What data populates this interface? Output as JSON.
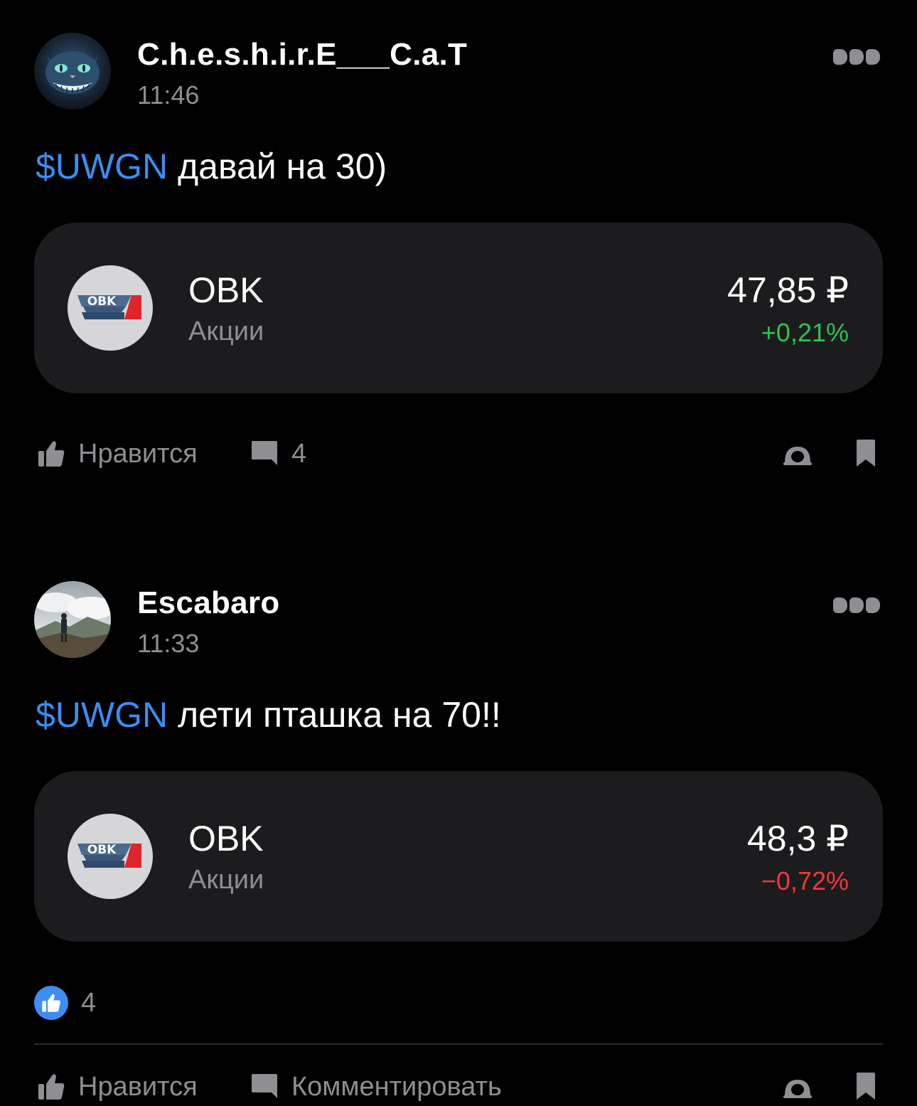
{
  "colors": {
    "background": "#000000",
    "card": "#1c1c1e",
    "muted": "#8e8e93",
    "ticker": "#3b8df0",
    "positive": "#2fc252",
    "negative": "#f0383a"
  },
  "icons": {
    "more": "more-dots-icon",
    "like": "thumbs-up-icon",
    "comment": "comment-bubble-icon",
    "share": "share-icon",
    "bookmark": "bookmark-icon"
  },
  "posts": [
    {
      "author": "C.h.e.s.h.i.r.E___C.a.T",
      "time": "11:46",
      "ticker": "$UWGN",
      "body": " давай на 30)",
      "instrument": {
        "logo_text": "OBK",
        "name": "OBK",
        "kind": "Акции",
        "price": "47,85 ₽",
        "change": "+0,21%",
        "trend": "up"
      },
      "actions": {
        "like_label": "Нравится",
        "comment_count": "4"
      }
    },
    {
      "author": "Escabaro",
      "time": "11:33",
      "ticker": "$UWGN",
      "body": " лети пташка на 70!!",
      "instrument": {
        "logo_text": "OBK",
        "name": "OBK",
        "kind": "Акции",
        "price": "48,3 ₽",
        "change": "−0,72%",
        "trend": "down"
      },
      "reactions": {
        "count": "4"
      },
      "actions": {
        "like_label": "Нравится",
        "comment_label": "Комментировать"
      }
    }
  ]
}
